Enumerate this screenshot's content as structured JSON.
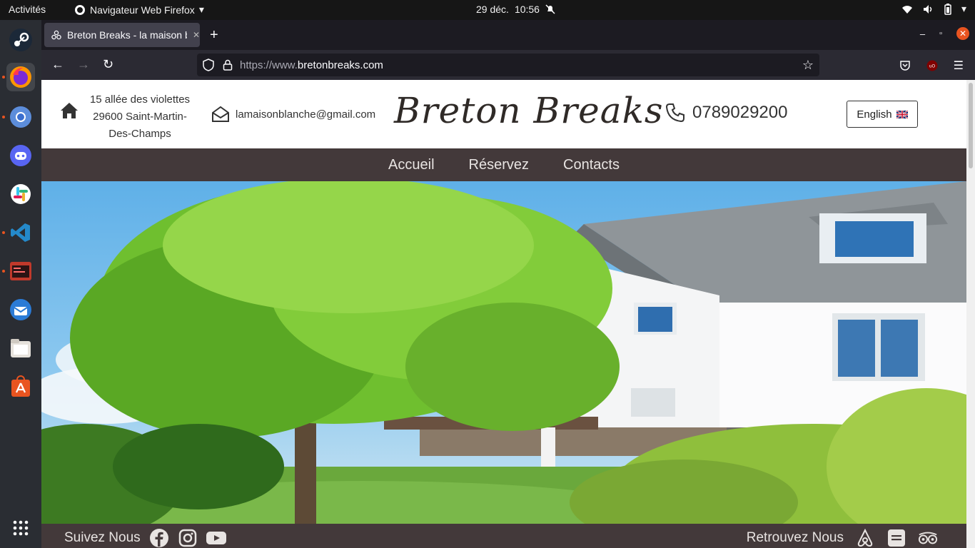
{
  "system": {
    "activities": "Activités",
    "app_menu": "Navigateur Web Firefox",
    "date": "29 déc.",
    "time": "10:56"
  },
  "browser": {
    "tab_title": "Breton Breaks - la maison blanche",
    "url_prefix": "https://www.",
    "url_domain": "bretonbreaks.com"
  },
  "site": {
    "address_line1": "15 allée des violettes",
    "address_line2": "29600 Saint-Martin-",
    "address_line3": "Des-Champs",
    "email": "lamaisonblanche@gmail.com",
    "brand": "Breton Breaks",
    "phone": "0789029200",
    "language_button": "English",
    "nav": [
      "Accueil",
      "Réservez",
      "Contacts"
    ],
    "footer_follow": "Suivez Nous",
    "footer_find": "Retrouvez Nous"
  },
  "colors": {
    "nav_bg": "#43393a",
    "accent_orange": "#e95420"
  }
}
